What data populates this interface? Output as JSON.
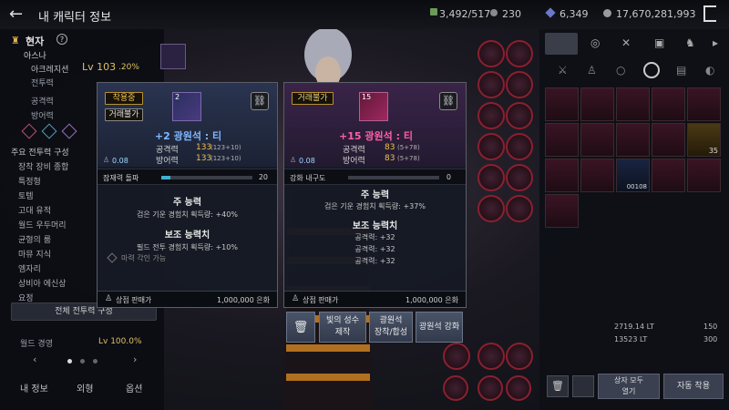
{
  "header": {
    "back": "←",
    "title": "내 캐릭터 정보",
    "inventory": "3,492/517",
    "coins": "230",
    "gems": "6,349",
    "money": "17,670,281,993"
  },
  "left": {
    "class_label": "현자",
    "help": "?",
    "server": "아스나",
    "name": "아크레지션",
    "level": "Lv 103",
    "level_pct": ".20%",
    "stat1": "전투력",
    "stat2": "공격력",
    "stat3": "방어력",
    "menu": [
      "주요 전투력 구성",
      "장착 장비 종합",
      "특정형",
      "토템",
      "고대 유적",
      "월드 우두머리",
      "균형의 룸",
      "마뮤 지식",
      "엠자리",
      "상비아 에신상",
      "요정"
    ],
    "combat_btn": "전체 전투력 구성",
    "field_label": "월드 경영",
    "field_val": "Lv 100.0%",
    "tabs": [
      "내 정보",
      "외형",
      "옵션"
    ]
  },
  "card_left": {
    "badge1": "착용중",
    "badge2": "거래불가",
    "icon_level": "2",
    "title": "+2 광원석 : 티",
    "atk_label": "공격력",
    "atk_val": "133",
    "atk_sub": "(123+10)",
    "def_label": "방어력",
    "def_val": "133",
    "def_sub": "(123+10)",
    "weight": "0.08",
    "bar_label": "잠재력 돌파",
    "bar_val": "20",
    "bar_fill": 0.1,
    "main_title": "주 능력",
    "main_line": "검은 기운 경험치 획득량: +40%",
    "sub_title": "보조 능력치",
    "sub_line": "필드 전투 경험치 획득량: +10%",
    "magic": "마력 각인 가능",
    "sell_label": "상점 판매가",
    "sell_val": "1,000,000 은화"
  },
  "card_right": {
    "badge": "거래불가",
    "icon_level": "15",
    "title": "+15 광원석 : 티",
    "atk_label": "공격력",
    "atk_val": "83",
    "atk_sub": "(5+78)",
    "def_label": "방어력",
    "def_val": "83",
    "def_sub": "(5+78)",
    "weight": "0.08",
    "bar_label": "강화 내구도",
    "bar_val": "0",
    "main_title": "주 능력",
    "main_line": "검은 기운 경험치 획득량: +37%",
    "sub_title": "보조 능력치",
    "sub_lines": [
      "공격력: +32",
      "공격력: +32",
      "공격력: +32"
    ],
    "sell_label": "상점 판매가",
    "sell_val": "1,000,000 은화"
  },
  "actions": {
    "delete": "🗑",
    "btn1": "빛의 성수\n제작",
    "btn2": "광원석\n장착/합성",
    "btn3": "광원석 강화"
  },
  "right": {
    "stat_a": "2719.14 LT",
    "stat_a2": "150",
    "stat_b": "13523 LT",
    "stat_b2": "300",
    "slot_nums": [
      "35",
      "00108"
    ],
    "btn_box": "상자 모두\n열기",
    "btn_auto": "자동 착용"
  },
  "colors": {
    "gold": "#f0c050",
    "pink": "#ff5fa8",
    "blue": "#7fb8ff"
  }
}
